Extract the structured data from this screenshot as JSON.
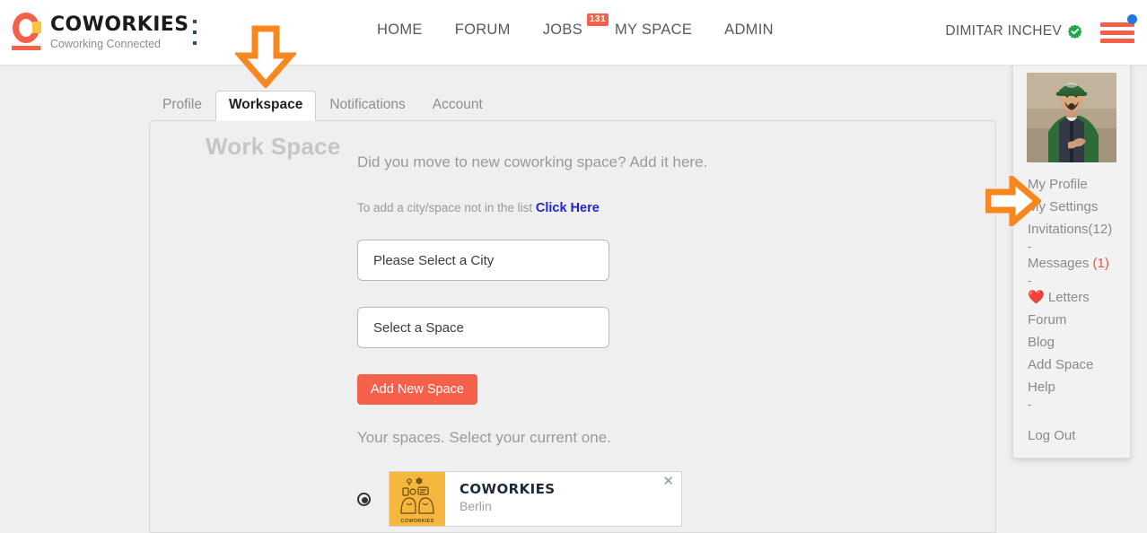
{
  "brand": {
    "name": "COWORKIES",
    "tagline": "Coworking Connected",
    "logo_primary": "#f4604a",
    "logo_accent": "#f8c341"
  },
  "header": {
    "kebab_icon": "more-vertical-icon",
    "nav": [
      {
        "label": "HOME",
        "badge": null
      },
      {
        "label": "FORUM",
        "badge": null
      },
      {
        "label": "JOBS",
        "badge": "131"
      },
      {
        "label": "MY SPACE",
        "badge": null
      },
      {
        "label": "ADMIN",
        "badge": null
      }
    ],
    "user": {
      "name": "DIMITAR INCHEV",
      "verified_icon": "verified-badge-icon",
      "verified_color": "#21a84b"
    },
    "hamburger_icon": "hamburger-menu-icon",
    "hamburger_color": "#f4604a",
    "notification_dot_color": "#1e7ae0"
  },
  "tabs": [
    {
      "label": "Profile",
      "active": false
    },
    {
      "label": "Workspace",
      "active": true
    },
    {
      "label": "Notifications",
      "active": false
    },
    {
      "label": "Account",
      "active": false
    }
  ],
  "main": {
    "title": "Work Space",
    "lead": "Did you move to new coworking space? Add it here.",
    "add_hint_prefix": "To add a city/space not in the list ",
    "add_hint_link": "Click Here",
    "city_select": {
      "value": "Please Select a City",
      "icon": "chevron-down-icon"
    },
    "space_select": {
      "value": "Select a Space",
      "icon": "chevron-down-icon"
    },
    "add_button": "Add New Space",
    "add_button_color": "#f4604a",
    "your_spaces_label": "Your spaces. Select your current one.",
    "spaces": [
      {
        "selected": true,
        "name": "COWORKIES",
        "city": "Berlin",
        "thumb_caption": "COWORKIES",
        "thumb_bg": "#f5b73d",
        "close_icon": "close-icon"
      }
    ]
  },
  "dropdown": {
    "avatar_icon": "user-avatar-photo",
    "items": [
      {
        "label": "My Profile",
        "type": "link"
      },
      {
        "label": "My Settings",
        "type": "link"
      },
      {
        "label": "Invitations(12)",
        "type": "link"
      },
      {
        "label": "-",
        "type": "separator"
      },
      {
        "label": "Messages ",
        "count": "(1)",
        "type": "link-count"
      },
      {
        "label": "-",
        "type": "separator"
      },
      {
        "label": "Letters",
        "icon": "heart-icon",
        "type": "link-icon"
      },
      {
        "label": "Forum",
        "type": "link"
      },
      {
        "label": "Blog",
        "type": "link"
      },
      {
        "label": "Add Space",
        "type": "link"
      },
      {
        "label": "Help",
        "type": "link"
      },
      {
        "label": "-",
        "type": "separator"
      },
      {
        "label": "",
        "type": "gap"
      },
      {
        "label": "Log Out",
        "type": "link"
      }
    ],
    "messages_count_color": "#e8553c"
  },
  "annotations": [
    {
      "icon": "arrow-down-annotation",
      "color": "#f7871f",
      "points_at": "workspace-tab"
    },
    {
      "icon": "arrow-right-annotation",
      "color": "#f7871f",
      "points_at": "my-settings-menu-item"
    }
  ]
}
